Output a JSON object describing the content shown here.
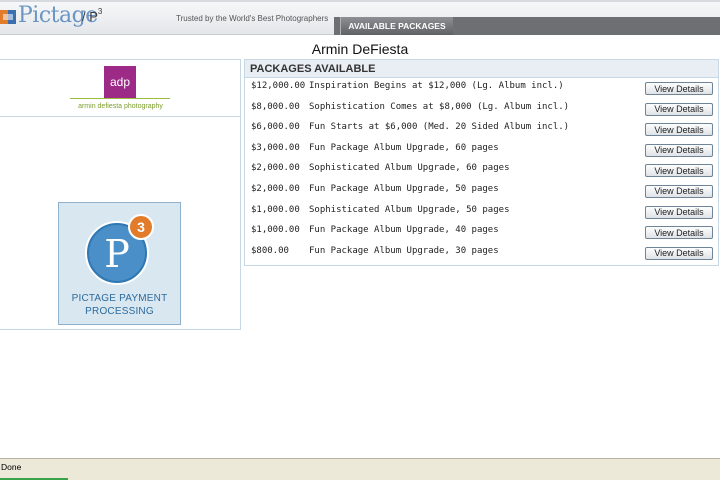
{
  "header": {
    "brand": "Pictage",
    "product": "/ P",
    "product_sup": "3",
    "tagline": "Trusted by the World's Best Photographers",
    "active_tab": "AVAILABLE PACKAGES"
  },
  "studio": {
    "name": "Armin DeFiesta",
    "logo_mark": "adp",
    "logo_caption": "armin defiesta photography"
  },
  "payment_badge": {
    "mark": "P",
    "mark_sup": "3",
    "caption_line1": "PICTAGE PAYMENT",
    "caption_line2": "PROCESSING"
  },
  "packages": {
    "title": "PACKAGES AVAILABLE",
    "button_label": "View Details",
    "items": [
      {
        "price": "$12,000.00",
        "name": "Inspiration Begins at $12,000 (Lg. Album incl.)"
      },
      {
        "price": "$8,000.00",
        "name": "Sophistication Comes at $8,000 (Lg. Album incl.)"
      },
      {
        "price": "$6,000.00",
        "name": "Fun Starts at $6,000 (Med. 20 Sided Album incl.)"
      },
      {
        "price": "$3,000.00",
        "name": "Fun Package Album Upgrade, 60 pages"
      },
      {
        "price": "$2,000.00",
        "name": "Sophisticated Album Upgrade, 60 pages"
      },
      {
        "price": "$2,000.00",
        "name": "Fun Package Album Upgrade, 50 pages"
      },
      {
        "price": "$1,000.00",
        "name": "Sophisticated Album Upgrade, 50 pages"
      },
      {
        "price": "$1,000.00",
        "name": "Fun Package Album Upgrade, 40 pages"
      },
      {
        "price": "$800.00",
        "name": "Fun Package Album Upgrade, 30 pages"
      }
    ]
  },
  "statusbar": {
    "text": "Done"
  },
  "colors": {
    "brand_blue": "#6b95c4",
    "adp_purple": "#9c2a86",
    "adp_green": "#7d9f2e",
    "badge_blue": "#2d6b9c",
    "tab_gray": "#6d6f72",
    "panel_border": "#c7d7e3"
  },
  "icons": [
    "pictage-logo-icon",
    "p3-payment-icon"
  ]
}
